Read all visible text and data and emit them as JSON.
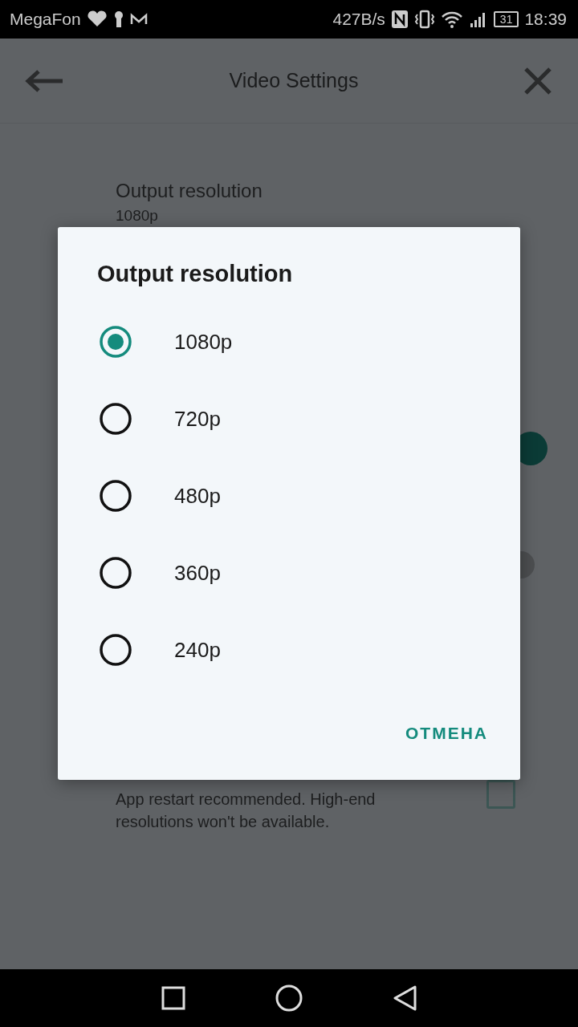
{
  "status_bar": {
    "carrier": "MegaFon",
    "net_speed": "427B/s",
    "battery": "31",
    "time": "18:39"
  },
  "app_bar": {
    "title": "Video Settings"
  },
  "settings": {
    "resolution": {
      "title": "Output resolution",
      "value": "1080p"
    },
    "toggles": [
      {
        "on": true
      },
      {
        "on": false
      }
    ],
    "compat": {
      "description": "App restart recommended. High-end resolutions won't be available.",
      "checked": false
    }
  },
  "dialog": {
    "title": "Output resolution",
    "options": [
      {
        "label": "1080p",
        "selected": true
      },
      {
        "label": "720p",
        "selected": false
      },
      {
        "label": "480p",
        "selected": false
      },
      {
        "label": "360p",
        "selected": false
      },
      {
        "label": "240p",
        "selected": false
      }
    ],
    "cancel": "ОТМЕНА"
  }
}
